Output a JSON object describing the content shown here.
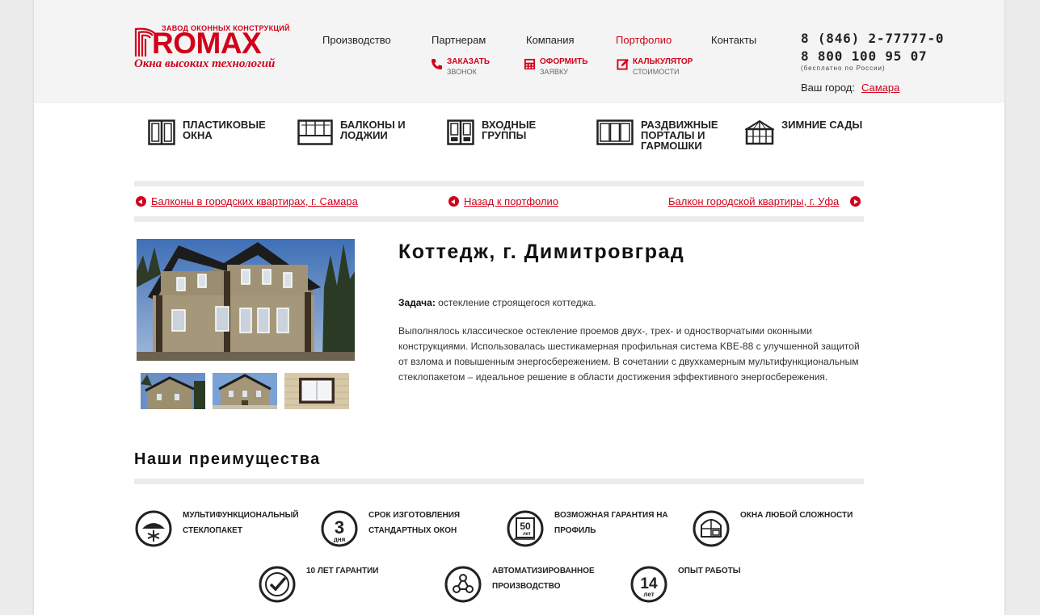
{
  "logo": {
    "top_text": "ЗАВОД ОКОННЫХ КОНСТРУКЦИЙ",
    "word": "ROMAX",
    "tagline": "Окна высоких технологий",
    "brand_color": "#d0021b"
  },
  "nav": {
    "items": [
      {
        "label": "Производство"
      },
      {
        "label": "Партнерам"
      },
      {
        "label": "Компания"
      },
      {
        "label": "Портфолио",
        "active": true
      },
      {
        "label": "Контакты"
      }
    ],
    "actions": [
      {
        "line1": "ЗАКАЗАТЬ",
        "line2": "ЗВОНОК",
        "icon": "phone-icon"
      },
      {
        "line1": "ОФОРМИТЬ",
        "line2": "ЗАЯВКУ",
        "icon": "calculator-grid-icon"
      },
      {
        "line1": "КАЛЬКУЛЯТОР",
        "line2": "СТОИМОСТИ",
        "icon": "edit-icon"
      }
    ]
  },
  "contacts": {
    "phone1": "8 (846) 2-77777-0",
    "phone2": "8 800 100 95 07",
    "note": "(бесплатно по России)",
    "city_label": "Ваш город:",
    "city_value": "Самара"
  },
  "categories": [
    {
      "label": "Пластиковые окна",
      "icon": "window-icon"
    },
    {
      "label": "Балконы и лоджии",
      "icon": "balcony-icon"
    },
    {
      "label": "Входные группы",
      "icon": "door-group-icon"
    },
    {
      "label": "Раздвижные порталы и гармошки",
      "icon": "sliding-portal-icon"
    },
    {
      "label": "Зимние сады",
      "icon": "winter-garden-icon"
    }
  ],
  "portfolio_nav": {
    "prev": "Балконы в городских квартирах, г. Самара",
    "back": "Назад к портфолио",
    "next": "Балкон городской квартиры, г. Уфа"
  },
  "project": {
    "title": "Коттедж, г. Димитровград",
    "task_label": "Задача:",
    "task_text": "остекление строящегося коттеджа.",
    "description": "Выполнялось классическое остекление проемов двух-, трех- и одностворчатыми оконными конструкциями. Использовалась шестикамерная профильная система KBE-88 с улучшенной защитой от взлома и повышенным энергосбережением. В сочетании с двухкамерным мультифункциональным стеклопакетом – идеальное решение в области достижения эффективного энергосбережения."
  },
  "advantages": {
    "title": "Наши преимущества",
    "items": [
      {
        "label": "Мультифункциональный стеклопакет",
        "icon": "snowflake-sun-icon"
      },
      {
        "label": "Срок изготовления стандартных окон",
        "icon": "three-days-icon",
        "badge_num": "3",
        "badge_unit": "дня"
      },
      {
        "label": "Возможная гарантия на профиль",
        "icon": "fifty-years-icon",
        "badge_num": "50",
        "badge_unit": "лет"
      },
      {
        "label": "Окна любой сложности",
        "icon": "complex-window-icon"
      },
      {
        "label": "10 лет гарантии",
        "icon": "check-clock-icon"
      },
      {
        "label": "Автоматизированное производство",
        "icon": "network-icon"
      },
      {
        "label": "Опыт работы",
        "icon": "fourteen-years-icon",
        "badge_num": "14",
        "badge_unit": "лет"
      }
    ]
  }
}
